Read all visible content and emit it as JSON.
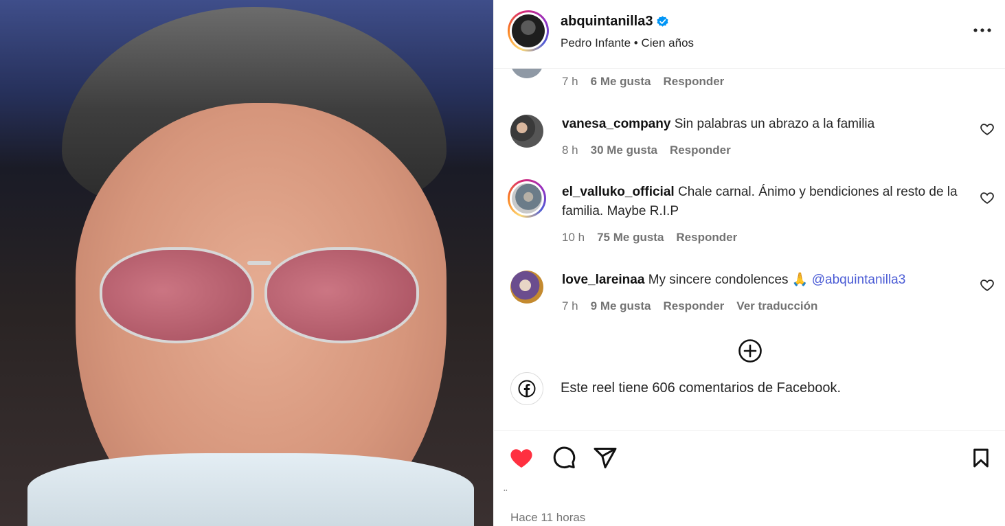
{
  "post": {
    "username": "abquintanilla3",
    "verified": true,
    "audio": "Pedro Infante • Cien años",
    "timestamp": "Hace 11 horas",
    "tiny_mark": "¸¸"
  },
  "comments": [
    {
      "user": "",
      "text": "",
      "time": "7 h",
      "likes": "6 Me gusta",
      "reply": "Responder"
    },
    {
      "user": "vanesa_company",
      "text": "Sin palabras un abrazo a la familia",
      "time": "8 h",
      "likes": "30 Me gusta",
      "reply": "Responder"
    },
    {
      "user": "el_valluko_official",
      "text": "Chale carnal. Ánimo y bendiciones al resto de la familia. Maybe R.I.P",
      "time": "10 h",
      "likes": "75 Me gusta",
      "reply": "Responder"
    },
    {
      "user": "love_lareinaa",
      "text": "My sincere condolences 🙏 ",
      "mention": "@abquintanilla3",
      "time": "7 h",
      "likes": "9 Me gusta",
      "reply": "Responder",
      "translate": "Ver traducción"
    }
  ],
  "facebook_note": "Este reel tiene 606 comentarios de Facebook.",
  "icons": {
    "more": "more-options-icon",
    "verified": "verified-badge-icon",
    "heart_small": "heart-outline-icon",
    "load_more": "plus-circle-icon",
    "facebook": "facebook-icon",
    "like": "heart-filled-icon",
    "comment": "comment-icon",
    "share": "send-icon",
    "save": "bookmark-icon"
  },
  "colors": {
    "like_red": "#ff3040",
    "verified_blue": "#0095f6",
    "mention_blue": "#4a5bd5",
    "muted_text": "#737373"
  }
}
